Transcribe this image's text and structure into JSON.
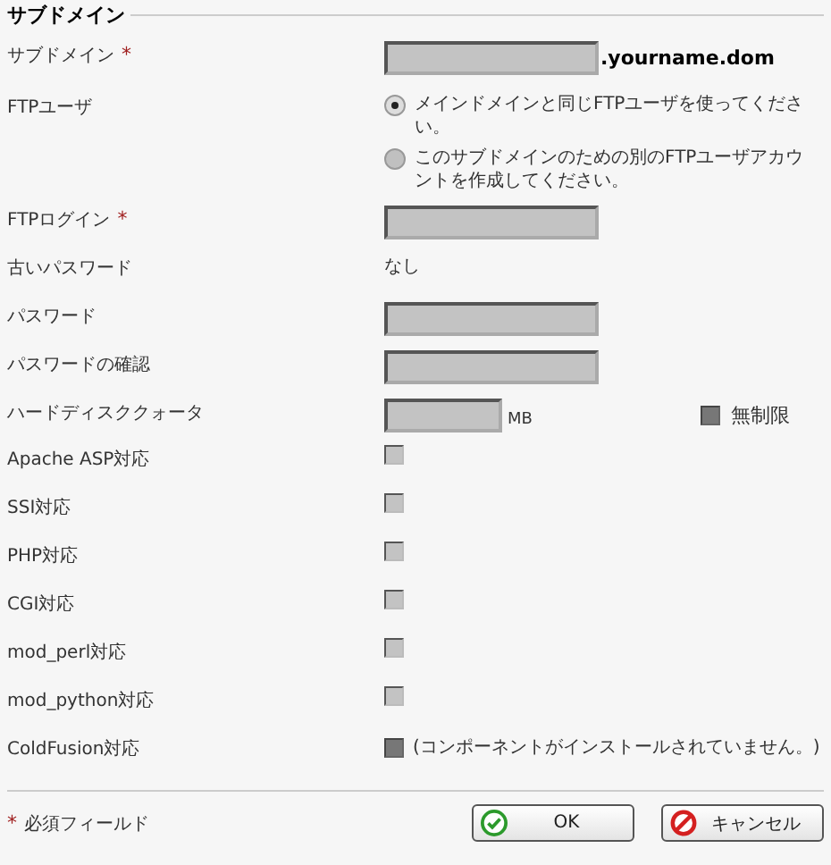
{
  "section": {
    "title": "サブドメイン"
  },
  "fields": [
    {
      "kind": "text",
      "label": "サブドメイン",
      "required_mark": "*",
      "suffix": ".yourname.dom"
    },
    {
      "kind": "radio",
      "label": "FTPユーザ",
      "options": [
        {
          "label": "メインドメインと同じFTPユーザを使ってください。",
          "selected": true
        },
        {
          "label": "このサブドメインのための別のFTPユーザアカウントを作成してください。",
          "selected": false
        }
      ]
    },
    {
      "kind": "text",
      "label": "FTPログイン",
      "required_mark": "*"
    },
    {
      "kind": "static",
      "label": "古いパスワード",
      "value": "なし"
    },
    {
      "kind": "text",
      "label": "パスワード"
    },
    {
      "kind": "text",
      "label": "パスワードの確認"
    },
    {
      "kind": "quota",
      "label": "ハードディスククォータ",
      "unit": "MB",
      "option": {
        "label": "無制限",
        "checked": false,
        "disabled": true
      }
    },
    {
      "kind": "checkbox",
      "label": "Apache ASP対応",
      "checked": false,
      "disabled": false
    },
    {
      "kind": "checkbox",
      "label": "SSI対応",
      "checked": false,
      "disabled": false
    },
    {
      "kind": "checkbox",
      "label": "PHP対応",
      "checked": false,
      "disabled": false
    },
    {
      "kind": "checkbox",
      "label": "CGI対応",
      "checked": false,
      "disabled": false
    },
    {
      "kind": "checkbox",
      "label": "mod_perl対応",
      "checked": false,
      "disabled": false
    },
    {
      "kind": "checkbox",
      "label": "mod_python対応",
      "checked": false,
      "disabled": false
    },
    {
      "kind": "checkbox",
      "label": "ColdFusion対応",
      "checked": false,
      "disabled": true,
      "note": "(コンポーネントがインストールされていません。)"
    }
  ],
  "footer": {
    "required_mark": "*",
    "required_note": "必須フィールド",
    "buttons": [
      {
        "kind": "ok",
        "label": "OK"
      },
      {
        "kind": "cancel",
        "label": "キャンセル"
      }
    ]
  }
}
